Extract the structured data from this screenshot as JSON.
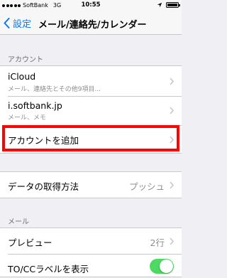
{
  "status_bar": {
    "carrier": "SoftBank",
    "network": "3G",
    "time": "10:55"
  },
  "nav": {
    "back_label": "設定",
    "title": "メール/連絡先/カレンダー"
  },
  "accounts_section": {
    "header": "アカウント",
    "items": [
      {
        "label": "iCloud",
        "sub": "メール、連絡先とその他9項目..."
      },
      {
        "label": "i.softbank.jp",
        "sub": "メール、メモ"
      },
      {
        "label": "アカウントを追加"
      }
    ]
  },
  "fetch_section": {
    "label": "データの取得方法",
    "value": "プッシュ"
  },
  "mail_section": {
    "header": "メール",
    "items": [
      {
        "label": "プレビュー",
        "value": "2行"
      },
      {
        "label": "TO/CCラベルを表示",
        "toggle": true
      }
    ]
  },
  "colors": {
    "accent": "#007aff",
    "highlight": "#ff0000",
    "toggle_on": "#4cd964"
  }
}
